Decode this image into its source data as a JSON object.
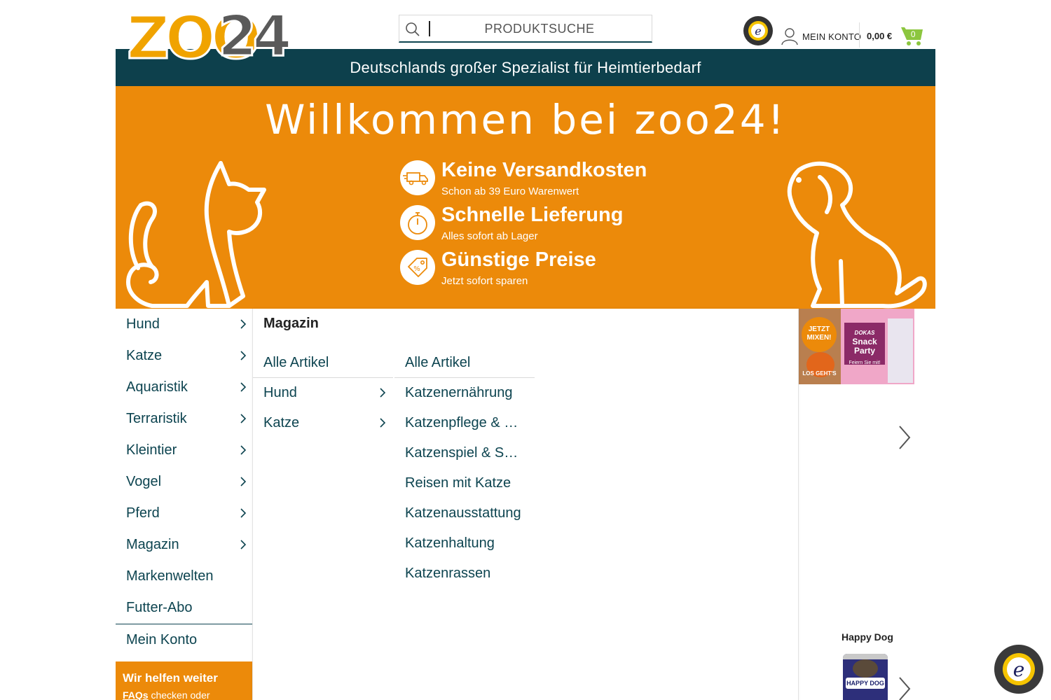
{
  "header": {
    "search_placeholder": "PRODUKTSUCHE",
    "account_label": "MEIN KONTO",
    "cart_price": "0,00 €",
    "cart_count": "0"
  },
  "tagline": "Deutschlands großer Spezialist für Heimtierbedarf",
  "hero": {
    "welcome": "Willkommen bei zoo24!",
    "usps": [
      {
        "title": "Keine Versandkosten",
        "sub": "Schon ab 39 Euro Warenwert",
        "icon": "truck-icon"
      },
      {
        "title": "Schnelle Lieferung",
        "sub": "Alles sofort ab Lager",
        "icon": "stopwatch-icon"
      },
      {
        "title": "Günstige Preise",
        "sub": "Jetzt sofort sparen",
        "icon": "price-tag-icon"
      }
    ]
  },
  "sidenav": {
    "items": [
      {
        "label": "Hund"
      },
      {
        "label": "Katze"
      },
      {
        "label": "Aquaristik"
      },
      {
        "label": "Terraristik"
      },
      {
        "label": "Kleintier"
      },
      {
        "label": "Vogel"
      },
      {
        "label": "Pferd"
      },
      {
        "label": "Magazin"
      },
      {
        "label": "Markenwelten"
      },
      {
        "label": "Futter-Abo"
      },
      {
        "label": "Mein Konto"
      }
    ]
  },
  "help": {
    "title": "Wir helfen weiter",
    "text_link": "FAQs",
    "text_rest": " checken oder"
  },
  "mega": {
    "title": "Magazin",
    "col1": [
      {
        "label": "Alle Artikel"
      },
      {
        "label": "Hund"
      },
      {
        "label": "Katze"
      }
    ],
    "col2": [
      {
        "label": "Alle Artikel"
      },
      {
        "label": "Katzenernährung"
      },
      {
        "label": "Katzenpflege & Gesundheit"
      },
      {
        "label": "Katzenspiel & Spaß"
      },
      {
        "label": "Reisen mit Katze"
      },
      {
        "label": "Katzenausstattung"
      },
      {
        "label": "Katzenhaltung"
      },
      {
        "label": "Katzenrassen"
      }
    ]
  },
  "promo": {
    "badge": "JETZT MIXEN!",
    "cta": "LOS GEHT'S",
    "brand": "DOKAS",
    "product": "Snack Party",
    "slogan": "Feiern Sie mit!"
  },
  "brand_card": {
    "label": "Happy Dog",
    "can_text": "HAPPY DOG"
  },
  "colors": {
    "orange": "#ec8a0a",
    "dark_teal": "#0d404c",
    "link_teal": "#0d4450",
    "cart_green": "#8cc63f"
  }
}
